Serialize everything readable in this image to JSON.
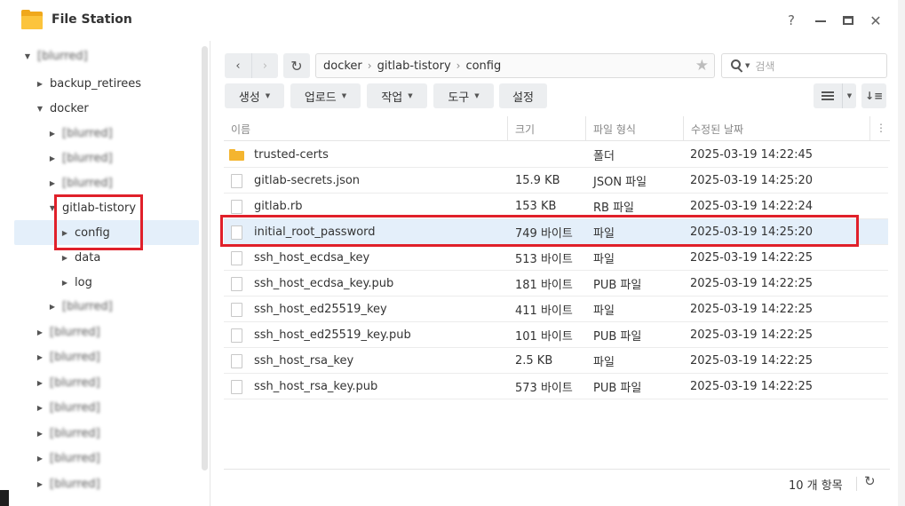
{
  "window": {
    "title": "File Station",
    "help_label": "?",
    "close_label": "✕"
  },
  "sidebar": {
    "root_label": "[blurred]",
    "items": [
      {
        "label": "backup_retirees"
      },
      {
        "label": "docker"
      },
      {
        "label": "[blurred]"
      },
      {
        "label": "[blurred]"
      },
      {
        "label": "[blurred]"
      },
      {
        "label": "gitlab-tistory"
      },
      {
        "label": "config"
      },
      {
        "label": "data"
      },
      {
        "label": "log"
      },
      {
        "label": "[blurred]"
      },
      {
        "label": "[blurred]"
      },
      {
        "label": "[blurred]"
      },
      {
        "label": "[blurred]"
      },
      {
        "label": "[blurred]"
      },
      {
        "label": "[blurred]"
      },
      {
        "label": "[blurred]"
      },
      {
        "label": "[blurred]"
      }
    ]
  },
  "toolbar": {
    "back_icon": "‹",
    "forward_icon": "›",
    "refresh_icon": "↻",
    "path": [
      "docker",
      "gitlab-tistory",
      "config"
    ],
    "path_separator": "›",
    "favorite_icon": "★",
    "search_placeholder": "검색",
    "buttons": [
      {
        "label": "생성"
      },
      {
        "label": "업로드"
      },
      {
        "label": "작업"
      },
      {
        "label": "도구"
      },
      {
        "label": "설정"
      }
    ],
    "sort_label": "↓≡"
  },
  "table": {
    "columns": [
      "이름",
      "크기",
      "파일 형식",
      "수정된 날짜"
    ],
    "more_icon": "⋮",
    "rows": [
      {
        "name": "trusted-certs",
        "size": "",
        "type": "폴더",
        "date": "2025-03-19 14:22:45",
        "kind": "folder"
      },
      {
        "name": "gitlab-secrets.json",
        "size": "15.9 KB",
        "type": "JSON 파일",
        "date": "2025-03-19 14:25:20",
        "kind": "file"
      },
      {
        "name": "gitlab.rb",
        "size": "153 KB",
        "type": "RB 파일",
        "date": "2025-03-19 14:22:24",
        "kind": "file"
      },
      {
        "name": "initial_root_password",
        "size": "749 바이트",
        "type": "파일",
        "date": "2025-03-19 14:25:20",
        "kind": "file"
      },
      {
        "name": "ssh_host_ecdsa_key",
        "size": "513 바이트",
        "type": "파일",
        "date": "2025-03-19 14:22:25",
        "kind": "file"
      },
      {
        "name": "ssh_host_ecdsa_key.pub",
        "size": "181 바이트",
        "type": "PUB 파일",
        "date": "2025-03-19 14:22:25",
        "kind": "file"
      },
      {
        "name": "ssh_host_ed25519_key",
        "size": "411 바이트",
        "type": "파일",
        "date": "2025-03-19 14:22:25",
        "kind": "file"
      },
      {
        "name": "ssh_host_ed25519_key.pub",
        "size": "101 바이트",
        "type": "PUB 파일",
        "date": "2025-03-19 14:22:25",
        "kind": "file"
      },
      {
        "name": "ssh_host_rsa_key",
        "size": "2.5 KB",
        "type": "파일",
        "date": "2025-03-19 14:22:25",
        "kind": "file"
      },
      {
        "name": "ssh_host_rsa_key.pub",
        "size": "573 바이트",
        "type": "PUB 파일",
        "date": "2025-03-19 14:22:25",
        "kind": "file"
      }
    ]
  },
  "footer": {
    "item_count": "10 개 항목",
    "refresh_icon": "↻"
  },
  "colors": {
    "selection": "#e4effa",
    "highlight_box": "#e0202a",
    "folder": "#f4b52f"
  }
}
